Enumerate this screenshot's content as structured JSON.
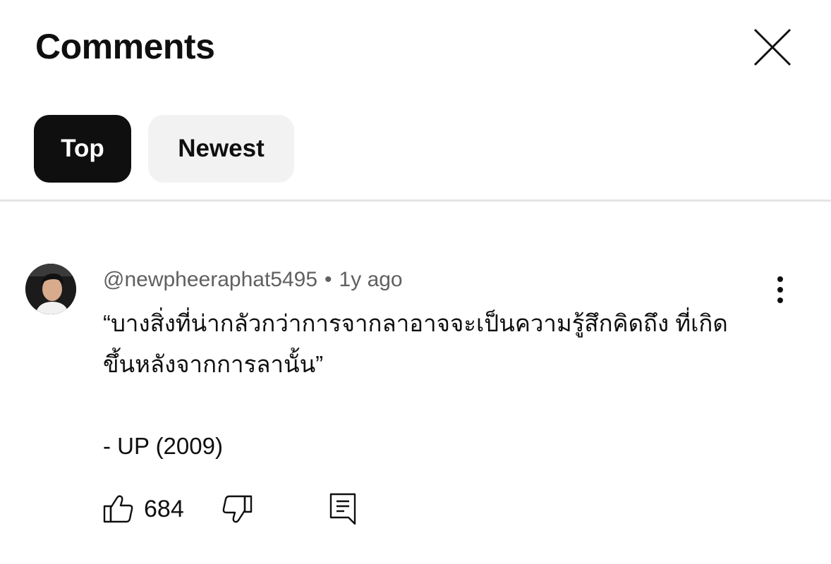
{
  "header": {
    "title": "Comments",
    "close_icon": "close-icon"
  },
  "sort_chips": [
    {
      "label": "Top",
      "active": true
    },
    {
      "label": "Newest",
      "active": false
    }
  ],
  "comment": {
    "author": "@newpheeraphat5495",
    "separator": "•",
    "time": "1y ago",
    "text": "“บางสิ่งที่น่ากลัวกว่าการจากลาอาจจะเป็นความรู้สึกคิดถึง ที่เกิดขึ้นหลังจากการลานั้น”\n\n- UP (2009)",
    "like_count": "684",
    "icons": {
      "avatar": "avatar",
      "more": "more-vert-icon",
      "like": "thumbs-up-icon",
      "dislike": "thumbs-down-icon",
      "reply": "reply-comment-icon"
    }
  },
  "colors": {
    "active_chip_bg": "#0f0f0f",
    "inactive_chip_bg": "#f2f2f2",
    "meta_text": "#606060",
    "divider": "#e5e5e5"
  }
}
